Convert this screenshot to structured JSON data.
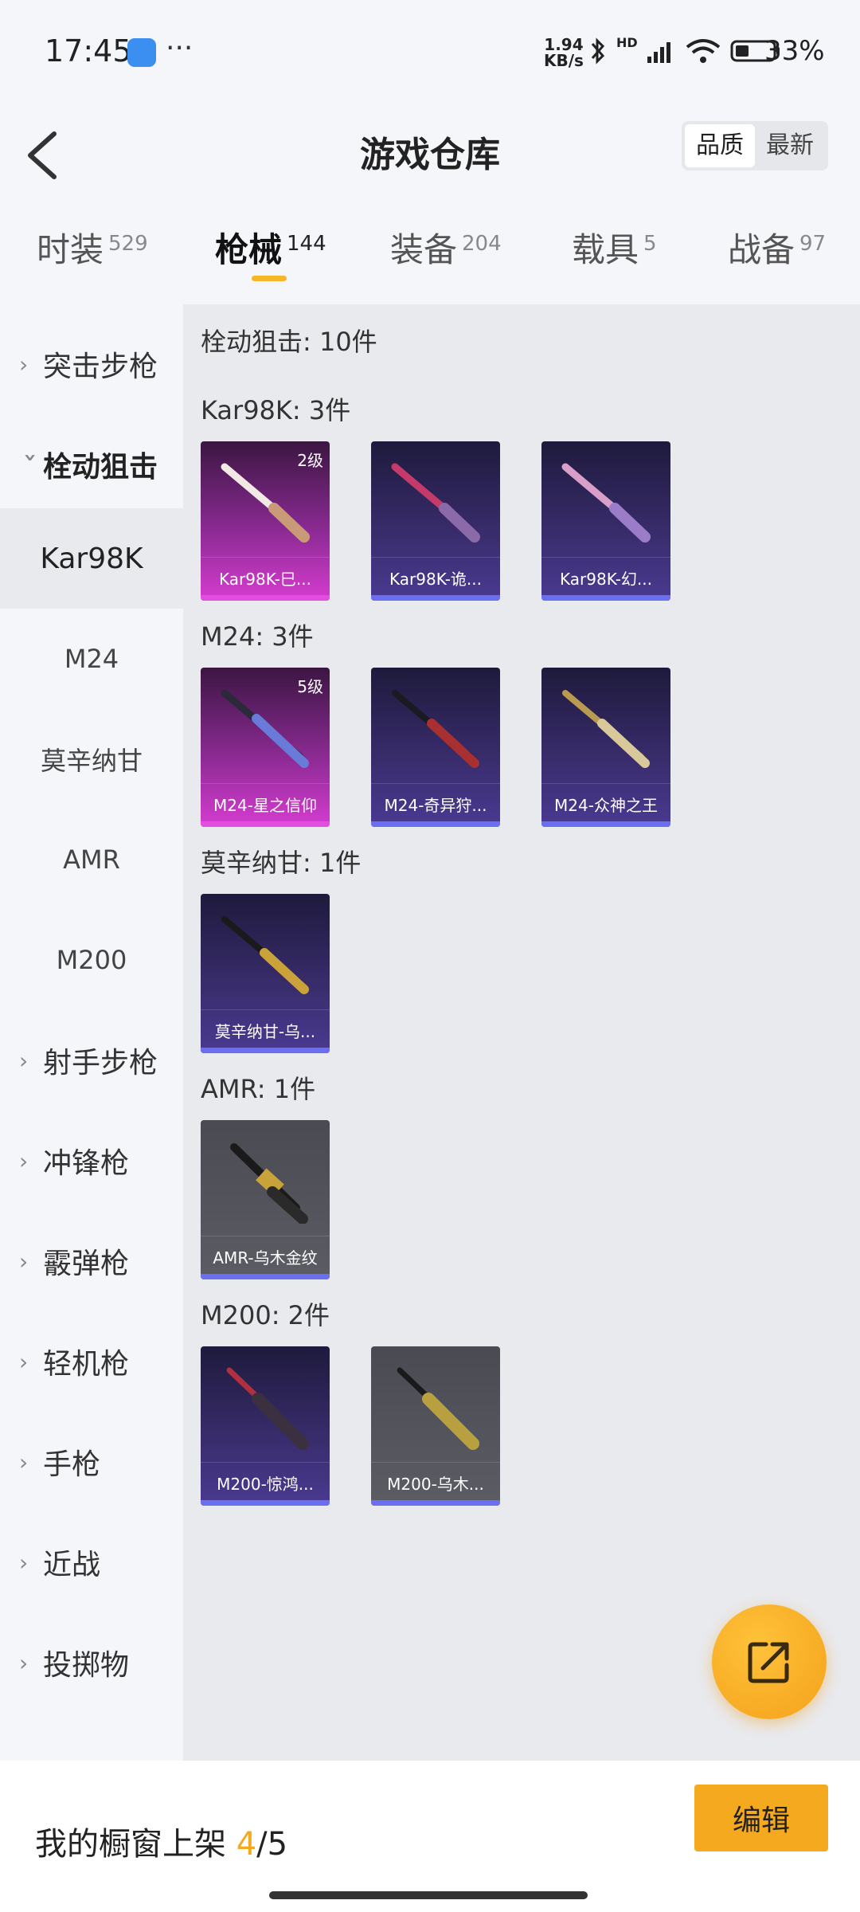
{
  "status_bar": {
    "time": "17:45",
    "more": "···",
    "net_speed_value": "1.94",
    "net_speed_unit": "KB/s",
    "hd_label": "HD",
    "battery": "33%",
    "icons": [
      "app-badge-icon",
      "bluetooth-icon",
      "signal-icon",
      "wifi-icon",
      "battery-icon"
    ]
  },
  "header": {
    "title": "游戏仓库",
    "sort": [
      "品质",
      "最新"
    ],
    "sort_active": "品质"
  },
  "tabs": [
    {
      "label": "时装",
      "count": "529"
    },
    {
      "label": "枪械",
      "count": "144"
    },
    {
      "label": "装备",
      "count": "204"
    },
    {
      "label": "载具",
      "count": "5"
    },
    {
      "label": "战备",
      "count": "97"
    }
  ],
  "sidebar": {
    "items": [
      {
        "label": "突击步枪"
      },
      {
        "label": "栓动狙击"
      },
      {
        "label": "Kar98K"
      },
      {
        "label": "M24"
      },
      {
        "label": "莫辛纳甘"
      },
      {
        "label": "AMR"
      },
      {
        "label": "M200"
      },
      {
        "label": "射手步枪"
      },
      {
        "label": "冲锋枪"
      },
      {
        "label": "霰弹枪"
      },
      {
        "label": "轻机枪"
      },
      {
        "label": "手枪"
      },
      {
        "label": "近战"
      },
      {
        "label": "投掷物"
      }
    ]
  },
  "content": {
    "total": "栓动狙击: 10件",
    "groups": [
      {
        "label": "Kar98K: 3件",
        "items": [
          {
            "name": "Kar98K-巳...",
            "level": "2级",
            "rarity": "pink"
          },
          {
            "name": "Kar98K-诡...",
            "rarity": "purple"
          },
          {
            "name": "Kar98K-幻...",
            "rarity": "purple"
          }
        ]
      },
      {
        "label": "M24: 3件",
        "items": [
          {
            "name": "M24-星之信仰",
            "level": "5级",
            "rarity": "pink"
          },
          {
            "name": "M24-奇异狩...",
            "rarity": "purple"
          },
          {
            "name": "M24-众神之王",
            "rarity": "purple"
          }
        ]
      },
      {
        "label": "莫辛纳甘: 1件",
        "items": [
          {
            "name": "莫辛纳甘-乌...",
            "rarity": "purple"
          }
        ]
      },
      {
        "label": "AMR: 1件",
        "items": [
          {
            "name": "AMR-乌木金纹",
            "rarity": "gray"
          }
        ]
      },
      {
        "label": "M200: 2件",
        "items": [
          {
            "name": "M200-惊鸿...",
            "rarity": "purple"
          },
          {
            "name": "M200-乌木...",
            "rarity": "gray"
          }
        ]
      }
    ]
  },
  "footer": {
    "shelf_label": "我的橱窗上架",
    "shelf_used": "4",
    "shelf_total": "/5",
    "edit_label": "编辑"
  },
  "colors": {
    "accent": "#f5a91f",
    "rarity_pink": "#d63cd0",
    "rarity_purple": "#4a3a92",
    "rarity_gray": "#5b5c64"
  }
}
